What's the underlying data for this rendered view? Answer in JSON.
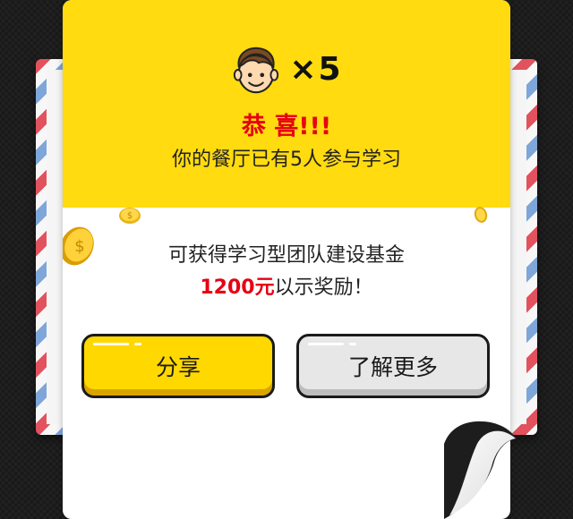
{
  "header": {
    "multiplier_text": "×5",
    "congrats_title": "恭 喜!!!",
    "congrats_subtitle": "你的餐厅已有5人参与学习"
  },
  "body": {
    "line1": "可获得学习型团队建设基金",
    "amount": "1200元",
    "line2_suffix": "以示奖励！"
  },
  "buttons": {
    "share_label": "分享",
    "learn_more_label": "了解更多"
  },
  "colors": {
    "header_yellow": "#ffdb0f",
    "accent_red": "#e60012",
    "share_button": "#ffd800",
    "learn_more_button": "#e7e7e7",
    "background": "#1d1d1d"
  },
  "icons": {
    "avatar": "smiling-boy-face-icon",
    "coins": "gold-coin-icon"
  }
}
